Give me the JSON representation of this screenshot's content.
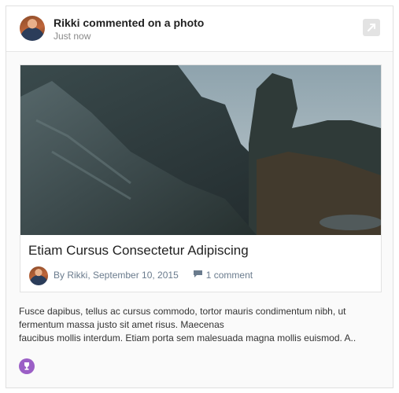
{
  "header": {
    "title": "Rikki commented on a photo",
    "time": "Just now"
  },
  "embed": {
    "title": "Etiam Cursus Consectetur Adipiscing",
    "byline": "By Rikki, September 10, 2015",
    "comments": "1 comment"
  },
  "body": {
    "line1": "Fusce dapibus, tellus ac cursus commodo, tortor mauris condimentum nibh, ut",
    "line2": "fermentum massa justo sit amet risus. Maecenas",
    "line3": "faucibus mollis interdum. Etiam porta sem malesuada magna mollis euismod. A.."
  },
  "icons": {
    "share": "share-icon",
    "comment": "comment-icon",
    "reaction": "trophy-icon"
  },
  "colors": {
    "meta": "#6a7b8d",
    "reaction": "#9b5fc6"
  }
}
